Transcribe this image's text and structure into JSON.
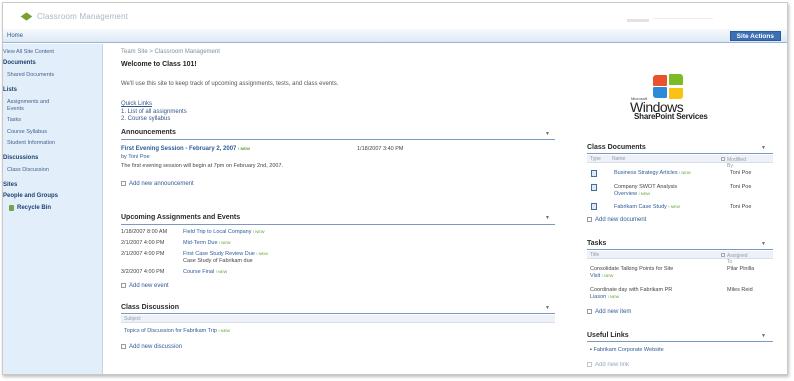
{
  "header": {
    "site_title": "Classroom Management",
    "home_tab": "Home",
    "site_actions": "Site Actions"
  },
  "leftnav": {
    "view_all": "View All Site Content",
    "documents": "Documents",
    "shared_documents": "Shared Documents",
    "lists": "Lists",
    "assignments_1": "Assignments and",
    "assignments_2": "Events",
    "tasks": "Tasks",
    "course_syllabus": "Course Syllabus",
    "student_information": "Student Information",
    "discussions": "Discussions",
    "class_discussion": "Class Discussion",
    "sites": "Sites",
    "people_groups": "People and Groups",
    "recycle_bin": "Recycle Bin"
  },
  "main": {
    "breadcrumb": "Team Site > Classroom Management",
    "page_title": "Welcome to Class 101!",
    "intro": "We'll use this site to keep track of upcoming assignments, tests, and class events.",
    "quick_links_title": "Quick Links",
    "quick_links": [
      "1. List of all assignments",
      "2. Course syllabus"
    ]
  },
  "announcements": {
    "title": "Announcements",
    "item_title": "First Evening Session - February 2, 2007",
    "item_new": "! NEW",
    "item_date": "1/18/2007 3:40 PM",
    "item_by": "by Toni Poe",
    "item_body": "The first evening session will begin at 7pm on February 2nd, 2007.",
    "add": "Add new announcement"
  },
  "events": {
    "title": "Upcoming Assignments and Events",
    "rows": [
      {
        "date": "1/18/2007 8:00 AM",
        "title": "Field Trip to Local Company",
        "new": "! NEW"
      },
      {
        "date": "2/1/2007 4:00 PM",
        "title": "Mid-Term Due",
        "new": "! NEW"
      },
      {
        "date": "2/1/2007 4:00 PM",
        "title": "First Case Study Review Due",
        "new": "! NEW"
      },
      {
        "date": "3/2/2007 4:00 PM",
        "title": "Course Final",
        "new": "! NEW"
      }
    ],
    "row3_note": "Case Study of Fabrikam due",
    "add": "Add new event"
  },
  "discussion": {
    "title": "Class Discussion",
    "col_subject": "Subject",
    "item": "Topics of Discussion for Fabrikam Trip",
    "item_new": "! NEW",
    "add": "Add new discussion"
  },
  "logo": {
    "microsoft": "Microsoft",
    "windows": "Windows",
    "sps": "SharePoint Services"
  },
  "class_documents": {
    "title": "Class Documents",
    "col_type": "Type",
    "col_name": "Name",
    "col_modified": "Modified By",
    "rows": [
      {
        "name": "Business Strategy Articles",
        "new": "! NEW",
        "by": "Toni Poe"
      },
      {
        "name": "Company SWOT Analysis",
        "name2": "Overview",
        "new": "! NEW",
        "by": "Toni Poe"
      },
      {
        "name": "Fabrikam Case Study",
        "new": "! NEW",
        "by": "Toni Poe"
      }
    ],
    "add": "Add new document"
  },
  "tasks": {
    "title": "Tasks",
    "col_title": "Title",
    "col_assigned": "Assigned To",
    "rows": [
      {
        "title": "Consolidate Talking Points for Site",
        "title2": "Visit",
        "new": "! NEW",
        "assigned": "Pilar Pinilla"
      },
      {
        "title": "Coordinate day with Fabrikam PR",
        "title2": "Liason",
        "new": "! NEW",
        "assigned": "Miles Reid"
      }
    ],
    "add": "Add new item"
  },
  "useful_links": {
    "title": "Useful Links",
    "item": "Fabrikam Corporate Website",
    "add": "Add new link"
  },
  "colors": {
    "accent": "#3d6fb5",
    "nav_bg": "#e3eefb",
    "new_badge": "#5a9a27"
  }
}
